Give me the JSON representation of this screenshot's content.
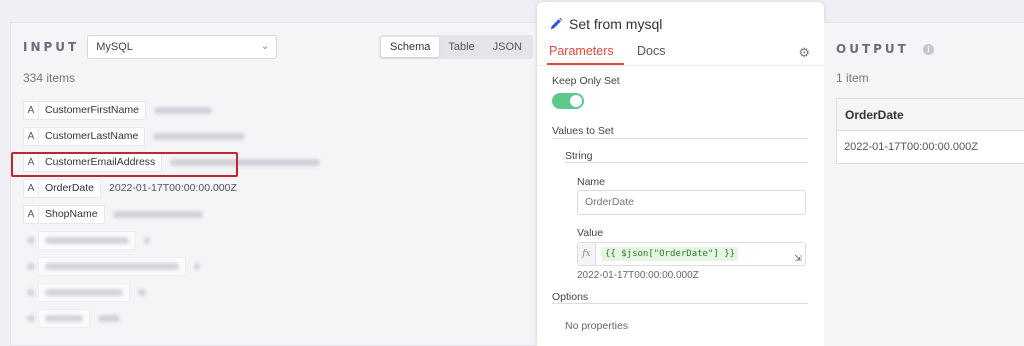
{
  "input": {
    "label": "INPUT",
    "node": "MySQL",
    "view_tabs": [
      "Schema",
      "Table",
      "JSON"
    ],
    "active_view": "Schema",
    "items_count": "334 items",
    "fields": [
      {
        "type": "A",
        "name": "CustomerFirstName"
      },
      {
        "type": "A",
        "name": "CustomerLastName"
      },
      {
        "type": "A",
        "name": "CustomerEmailAddress"
      },
      {
        "type": "A",
        "name": "OrderDate",
        "value": "2022-01-17T00:00:00.000Z"
      },
      {
        "type": "A",
        "name": "ShopName"
      }
    ]
  },
  "params": {
    "title": "Set from mysql",
    "tabs": [
      "Parameters",
      "Docs"
    ],
    "active_tab": "Parameters",
    "keep_only_set_label": "Keep Only Set",
    "keep_only_set": true,
    "values_to_set_label": "Values to Set",
    "string_label": "String",
    "name_label": "Name",
    "name_value": "OrderDate",
    "value_label": "Value",
    "value_expression": "{{ $json[\"OrderDate\"] }}",
    "value_result": "2022-01-17T00:00:00.000Z",
    "options_label": "Options",
    "no_properties": "No properties"
  },
  "output": {
    "label": "OUTPUT",
    "items_count": "1 item",
    "column": "OrderDate",
    "cell": "2022-01-17T00:00:00.000Z"
  },
  "colors": {
    "accent": "#e0493c",
    "toggle_on": "#5cc98d",
    "highlight": "#c0262d",
    "pencil": "#2f54d8"
  },
  "icons": [
    "pencil-icon",
    "gear-icon",
    "info-icon",
    "chevron-down-icon",
    "fx-icon",
    "expand-icon"
  ]
}
